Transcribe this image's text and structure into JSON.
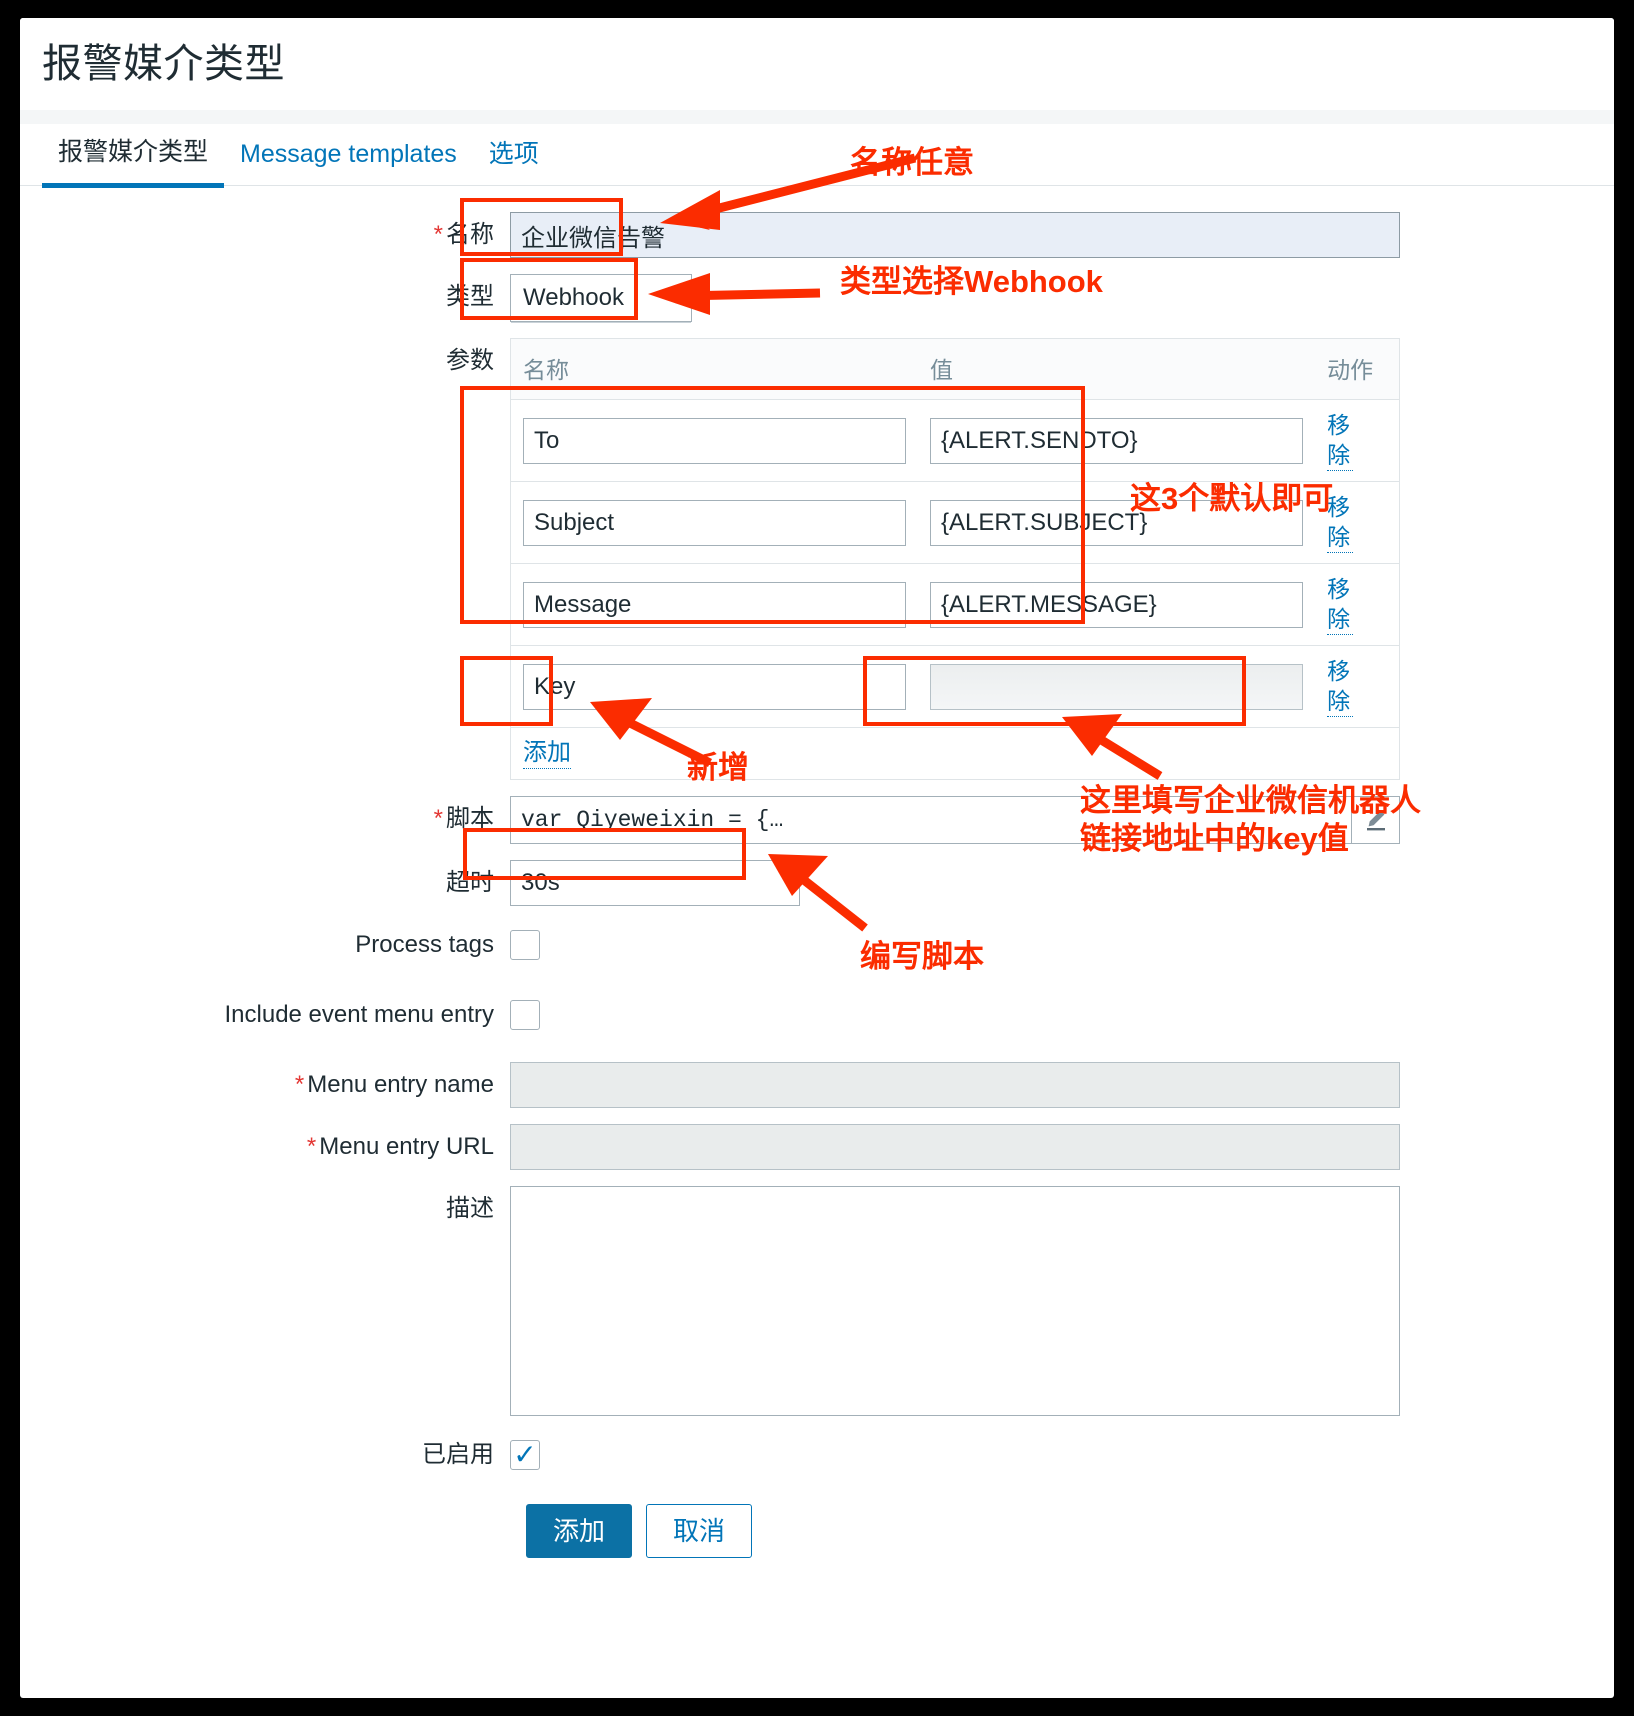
{
  "header": {
    "title": "报警媒介类型"
  },
  "tabs": [
    {
      "label": "报警媒介类型",
      "active": true
    },
    {
      "label": "Message templates",
      "active": false
    },
    {
      "label": "选项",
      "active": false
    }
  ],
  "form": {
    "name": {
      "label": "名称",
      "required": true,
      "value": "企业微信告警"
    },
    "type": {
      "label": "类型",
      "required": false,
      "value": "Webhook",
      "chevron": "chevron-down-icon"
    },
    "parameters": {
      "label": "参数",
      "columns": [
        "名称",
        "值",
        "动作"
      ],
      "rows": [
        {
          "name": "To",
          "value": "{ALERT.SENDTO}",
          "action": "移除"
        },
        {
          "name": "Subject",
          "value": "{ALERT.SUBJECT}",
          "action": "移除"
        },
        {
          "name": "Message",
          "value": "{ALERT.MESSAGE}",
          "action": "移除"
        },
        {
          "name": "Key",
          "value": "",
          "action": "移除"
        }
      ],
      "add_label": "添加"
    },
    "script": {
      "label": "脚本",
      "required": true,
      "value": "var Qiyeweixin = {…",
      "edit_icon": "pencil-icon"
    },
    "timeout": {
      "label": "超时",
      "value": "30s"
    },
    "process_tags": {
      "label": "Process tags",
      "checked": false
    },
    "include_event_menu_entry": {
      "label": "Include event menu entry",
      "checked": false
    },
    "menu_entry_name": {
      "label": "Menu entry name",
      "required": true,
      "value": "",
      "disabled": true
    },
    "menu_entry_url": {
      "label": "Menu entry URL",
      "required": true,
      "value": "",
      "disabled": true
    },
    "description": {
      "label": "描述",
      "value": ""
    },
    "enabled": {
      "label": "已启用",
      "checked": true
    },
    "buttons": {
      "submit": "添加",
      "cancel": "取消"
    }
  },
  "annotations": {
    "name_note": "名称任意",
    "type_note": "类型选择Webhook",
    "defaults_note": "这3个默认即可",
    "add_note": "新增",
    "key_note_line1": "这里填写企业微信机器人",
    "key_note_line2": "链接地址中的key值",
    "script_note": "编写脚本"
  },
  "colors": {
    "annotation": "#fb2c00",
    "accent": "#0275b8",
    "primary_button": "#0c71a5",
    "required": "#e33734"
  }
}
